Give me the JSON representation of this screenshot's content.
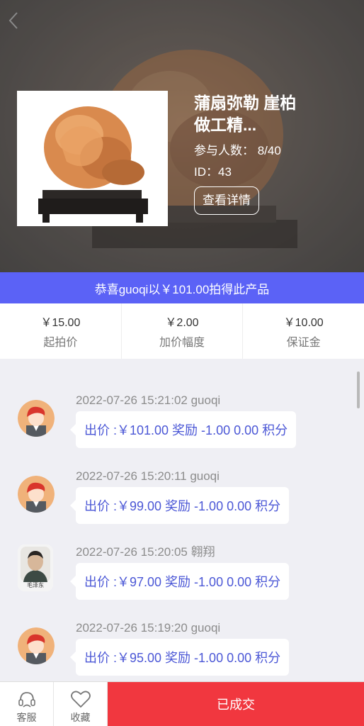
{
  "product": {
    "title": "蒲扇弥勒 崖柏 做工精...",
    "participants": "参与人数： 8/40",
    "id_text": "ID：43",
    "detail_button": "查看详情"
  },
  "banner": {
    "text": "恭喜guoqi以￥101.00拍得此产品"
  },
  "stats": [
    {
      "value": "￥15.00",
      "label": "起拍价"
    },
    {
      "value": "￥2.00",
      "label": "加价幅度"
    },
    {
      "value": "￥10.00",
      "label": "保证金"
    }
  ],
  "bids": [
    {
      "time_user": "2022-07-26 15:21:02 guoqi",
      "detail": "出价 :￥101.00 奖励 -1.00 0.00 积分",
      "avatar": "cartoon-avatar"
    },
    {
      "time_user": "2022-07-26 15:20:11 guoqi",
      "detail": "出价 :￥99.00 奖励 -1.00 0.00 积分",
      "avatar": "cartoon-avatar"
    },
    {
      "time_user": "2022-07-26 15:20:05 翱翔",
      "detail": "出价 :￥97.00 奖励 -1.00 0.00 积分",
      "avatar": "portrait-avatar",
      "avatar_caption": "毛泽东"
    },
    {
      "time_user": "2022-07-26 15:19:20 guoqi",
      "detail": "出价 :￥95.00 奖励 -1.00 0.00 积分",
      "avatar": "cartoon-avatar"
    }
  ],
  "bottom_bar": {
    "service_label": "客服",
    "favorite_label": "收藏",
    "status_button": "已成交"
  },
  "colors": {
    "banner": "#5b62f6",
    "bid_text": "#4b57d6",
    "deal_button": "#f1373f"
  }
}
